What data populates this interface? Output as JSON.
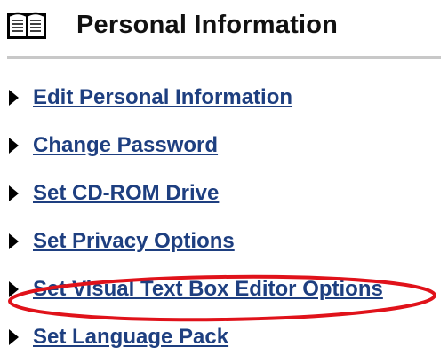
{
  "header": {
    "title": "Personal Information",
    "icon": "open-book-icon"
  },
  "menu": {
    "items": [
      {
        "label": "Edit Personal Information"
      },
      {
        "label": "Change Password"
      },
      {
        "label": "Set CD-ROM Drive"
      },
      {
        "label": "Set Privacy Options"
      },
      {
        "label": "Set Visual Text Box Editor Options",
        "highlighted": true
      },
      {
        "label": "Set Language Pack"
      }
    ]
  },
  "colors": {
    "link": "#1e3f80",
    "highlight": "#e0121a",
    "divider": "#c8c8c8"
  }
}
